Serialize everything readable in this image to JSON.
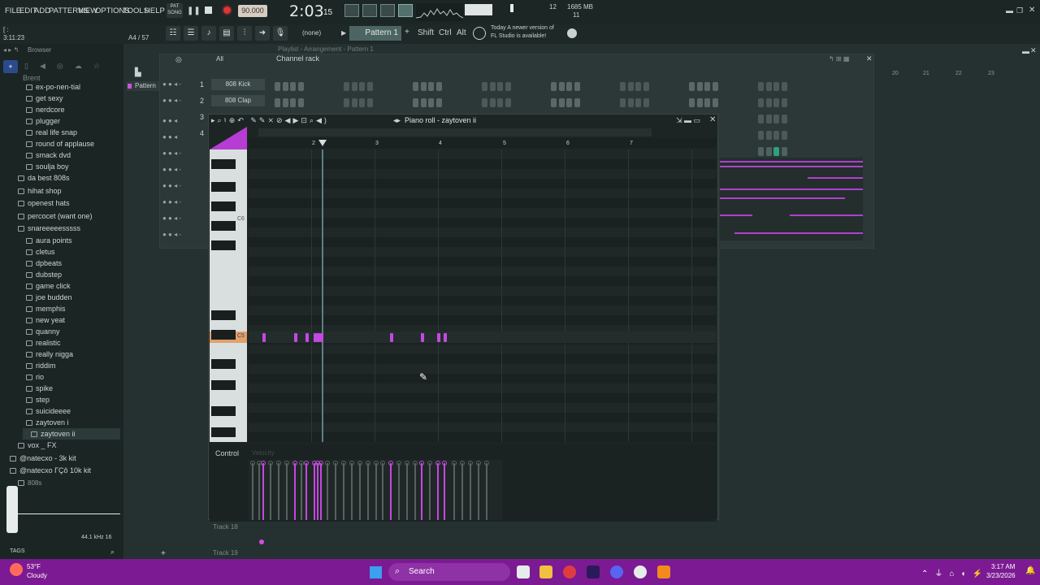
{
  "menu": [
    "FILE",
    "EDIT",
    "ADD",
    "PATTERNS",
    "VIEW",
    "OPTIONS",
    "TOOLS",
    "HELP"
  ],
  "transport": {
    "tempo": "90.000",
    "time": "2:03",
    "time_small": "15",
    "cpu": "12",
    "memory": "1685 MB",
    "voices": "11",
    "mode": "SONG",
    "pat": "PAT"
  },
  "toolbar": {
    "position": "3:11:23",
    "channel_info": "A4 / 57",
    "snap": "(none)",
    "pattern": "Pattern 1",
    "shift": "Shift",
    "ctrl": "Ctrl",
    "alt": "Alt",
    "news_line1": "Today  A newer version of",
    "news_line2": "FL Studio is available!"
  },
  "browser": {
    "title": "Browser",
    "items": [
      "ex-po-nen-tial",
      "get sexy",
      "nerdcore",
      "plugger",
      "real life snap",
      "round of applause",
      "smack dvd",
      "soulja boy",
      "da best 808s",
      "hihat shop",
      "openest hats",
      "percocet (want one)",
      "snareeeeesssss",
      "aura points",
      "cletus",
      "dpbeats",
      "dubstep",
      "game click",
      "joe budden",
      "memphis",
      "new yeat",
      "quanny",
      "realistic",
      "really nigga",
      "riddim",
      "rio",
      "spike",
      "step",
      "suicideeee",
      "zaytoven i",
      "zaytoven ii",
      "vox _ FX",
      "@natecxo - 3k kit",
      "@natecxo ГÇô 10k kit",
      "808s"
    ],
    "sample_rate": "44.1 kHz 16",
    "tags": "TAGS"
  },
  "playlist": {
    "title": "Playlist - Arrangement - Pattern 1",
    "pattern_label": "Pattern",
    "bars": [
      "20",
      "21",
      "22",
      "23"
    ]
  },
  "channel_rack": {
    "title": "Channel rack",
    "filter": "All",
    "channels": [
      {
        "num": "1",
        "name": "808 Kick"
      },
      {
        "num": "2",
        "name": "808 Clap"
      },
      {
        "num": "3",
        "name": ""
      },
      {
        "num": "4",
        "name": ""
      }
    ]
  },
  "piano_roll": {
    "title": "Piano roll - zaytoven ii",
    "ruler": [
      "2",
      "3",
      "4",
      "5",
      "6",
      "7"
    ],
    "c6": "C6",
    "c5": "C5",
    "control": "Control",
    "velocity": "Velocity",
    "track18": "Track 18",
    "track19": "Track 19"
  },
  "taskbar": {
    "temp": "53°F",
    "weather": "Cloudy",
    "search": "Search",
    "clock": "3:17 AM",
    "date": "3/23/2026"
  }
}
